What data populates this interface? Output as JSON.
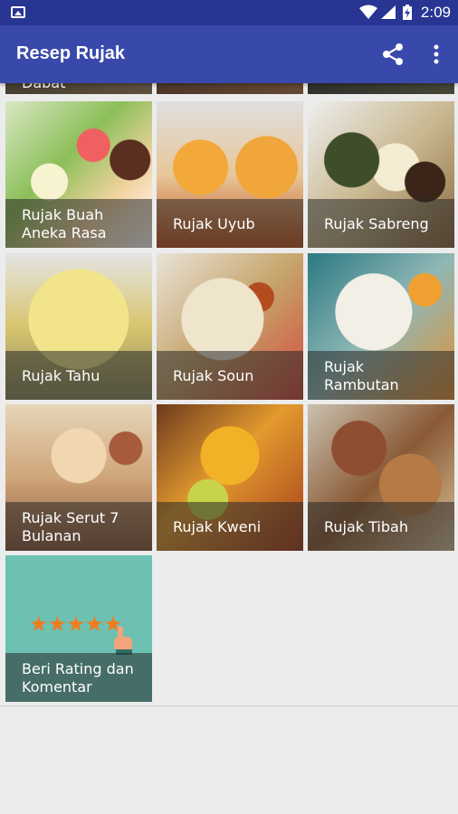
{
  "status_bar": {
    "time": "2:09",
    "icons": [
      "image-icon",
      "wifi-icon",
      "signal-icon",
      "battery-charging-icon"
    ]
  },
  "app_bar": {
    "title": "Resep Rujak",
    "actions": [
      "share-icon",
      "more-vert-icon"
    ]
  },
  "partial_top": {
    "first_label_fragment": "Dabat"
  },
  "items": [
    {
      "label": "Rujak Buah Aneka Rasa"
    },
    {
      "label": "Rujak Uyub"
    },
    {
      "label": "Rujak Sabreng"
    },
    {
      "label": "Rujak Tahu"
    },
    {
      "label": "Rujak Soun"
    },
    {
      "label": "Rujak Rambutan"
    },
    {
      "label": "Rujak Serut 7 Bulanan"
    },
    {
      "label": "Rujak Kweni"
    },
    {
      "label": "Rujak Tibah"
    },
    {
      "label": "Beri Rating dan Komentar",
      "stars": "★★★★★"
    }
  ],
  "colors": {
    "status_bar": "#283593",
    "app_bar": "#3949ab",
    "rating_tile": "#6cc1b3",
    "star": "#f07c20"
  }
}
